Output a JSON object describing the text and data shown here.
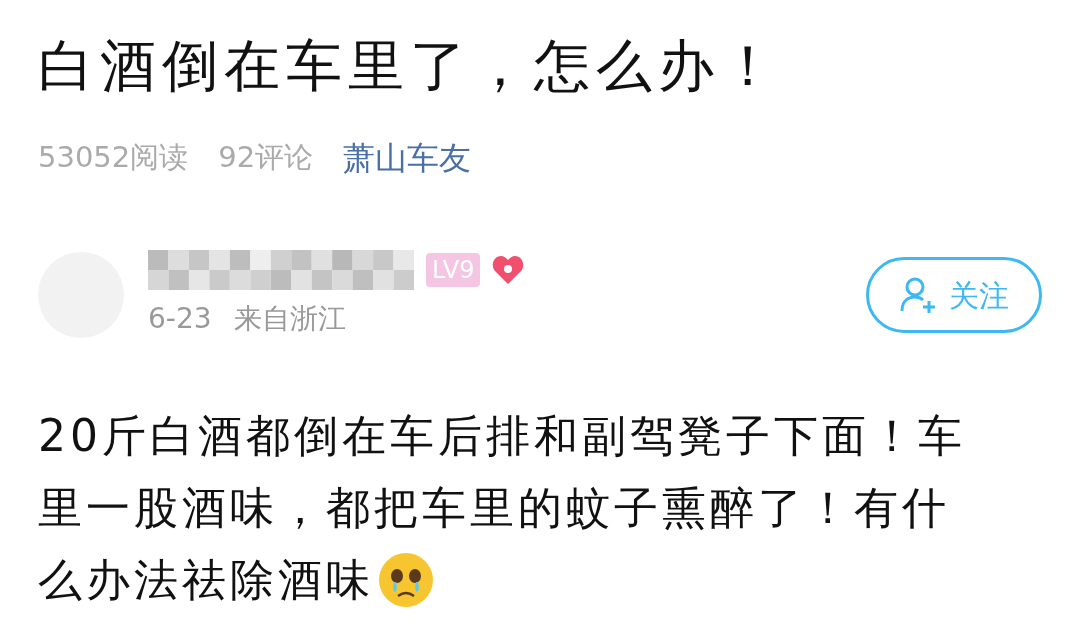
{
  "post": {
    "title": "白酒倒在车里了，怎么办！",
    "reads": "53052阅读",
    "comments": "92评论",
    "group": "萧山车友"
  },
  "author": {
    "level": "LV9",
    "date": "6-23",
    "location": "来自浙江",
    "follow_label": "关注"
  },
  "body_lines": [
    "20斤白酒都倒在车后排和副驾凳子下面！车",
    "里一股酒味，都把车里的蚊子熏醉了！有什",
    "么办法祛除酒味"
  ]
}
